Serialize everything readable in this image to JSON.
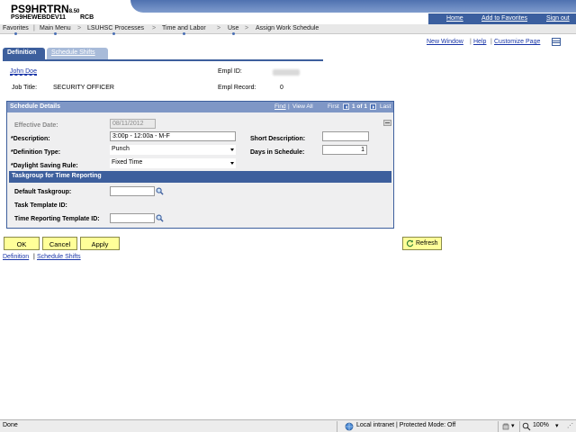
{
  "header": {
    "system_title": "PS9HRTRN",
    "version": "8.50",
    "db_name": "PS9HEWEBDEV11",
    "db_sub": "RCB",
    "links": [
      "Home",
      "Add to Favorites",
      "Sign out"
    ]
  },
  "breadcrumb": [
    "Favorites",
    "Main Menu",
    "LSUHSC Processes",
    "Time and Labor",
    "Use",
    "Assign Work Schedule"
  ],
  "page_links": [
    "New Window",
    "Help",
    "Customize Page"
  ],
  "tabs": {
    "active": "Definition",
    "inactive": "Schedule Shifts"
  },
  "employee": {
    "name": "John Doe",
    "job_title_label": "Job Title:",
    "job_title": "SECURITY OFFICER",
    "empl_id_label": "Empl ID:",
    "empl_record_label": "Empl Record:",
    "empl_record": "0"
  },
  "schedule_panel": {
    "title": "Schedule Details",
    "find": "Find",
    "view_all": "View All",
    "first": "First",
    "pager": "1 of 1",
    "last": "Last",
    "effective_date_label": "Effective Date:",
    "effective_date": "08/11/2012",
    "description_label": "*Description:",
    "description": "3:00p - 12:00a - M-F",
    "short_description_label": "Short Description:",
    "short_description": "",
    "definition_type_label": "*Definition Type:",
    "definition_type": "Punch",
    "days_in_schedule_label": "Days in Schedule:",
    "days_in_schedule": "1",
    "dst_rule_label": "*Daylight Saving Rule:",
    "dst_rule": "Fixed Time",
    "taskgroup_title": "Taskgroup for Time Reporting",
    "default_taskgroup_label": "Default Taskgroup:",
    "default_taskgroup": "",
    "task_template_label": "Task Template ID:",
    "time_reporting_template_label": "Time Reporting Template ID:",
    "time_reporting_template": ""
  },
  "buttons": {
    "ok": "OK",
    "cancel": "Cancel",
    "apply": "Apply",
    "refresh": "Refresh"
  },
  "footer_links": [
    "Definition",
    "Schedule Shifts"
  ],
  "statusbar": {
    "status": "Done",
    "zone": "Local intranet | Protected Mode: Off",
    "zoom": "100%"
  }
}
